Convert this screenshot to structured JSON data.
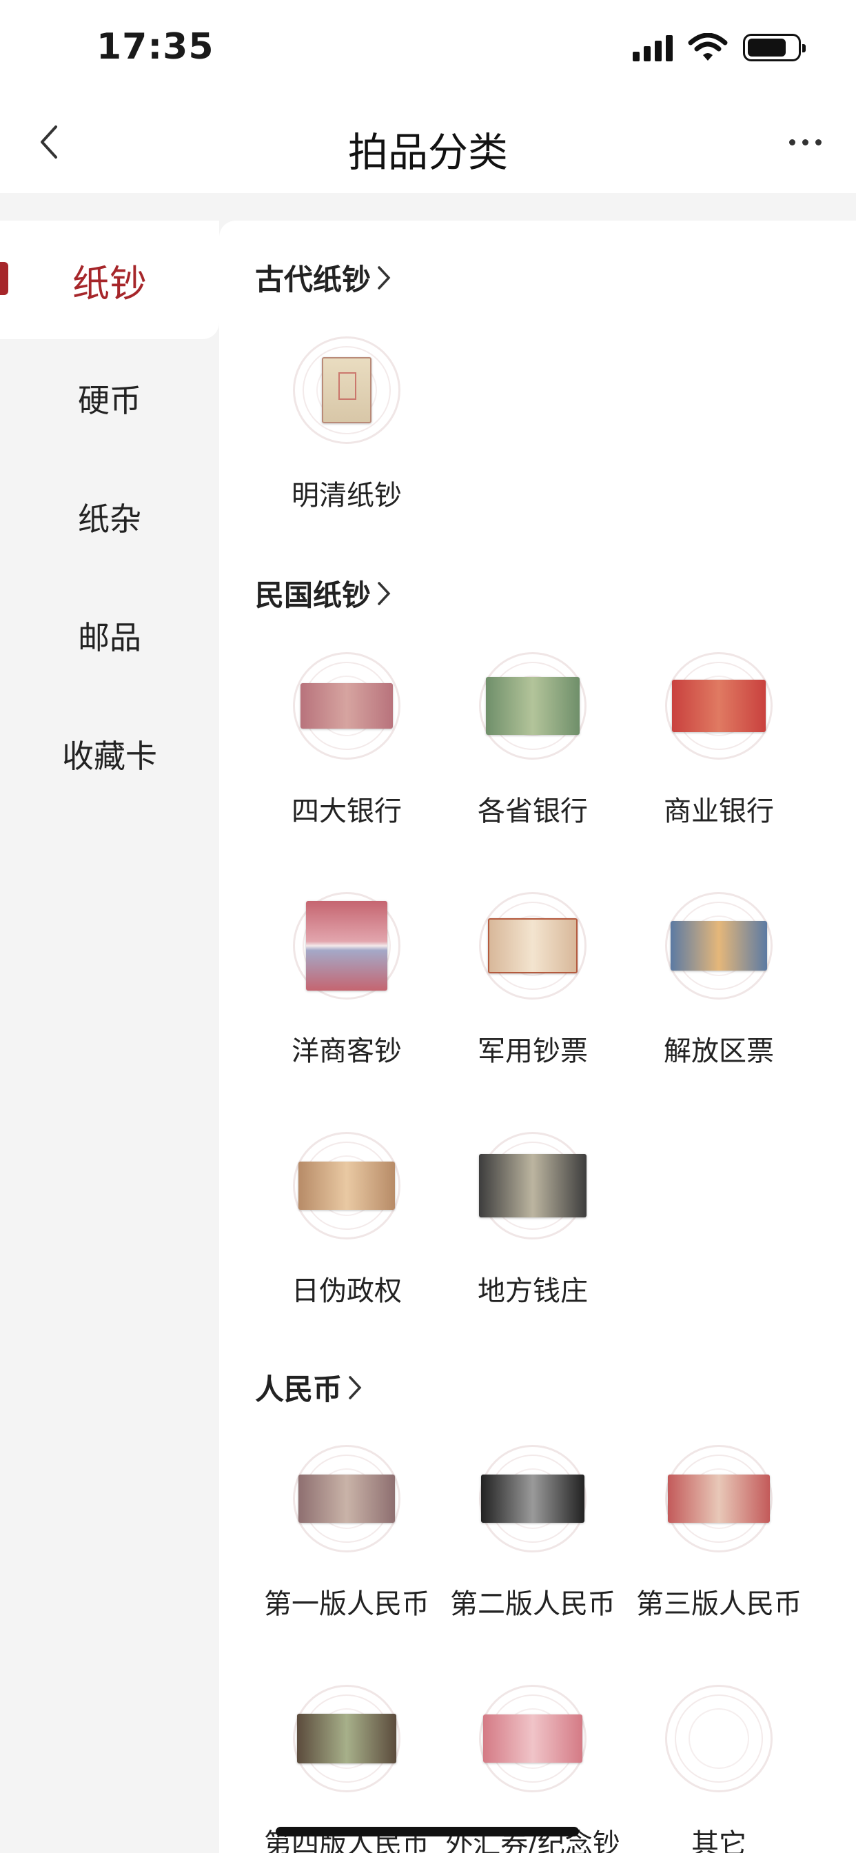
{
  "status_bar": {
    "time": "17:35"
  },
  "nav": {
    "title": "拍品分类"
  },
  "sidebar": {
    "items": [
      {
        "label": "纸钞",
        "active": true
      },
      {
        "label": "硬币"
      },
      {
        "label": "纸杂"
      },
      {
        "label": "邮品"
      },
      {
        "label": "收藏卡"
      }
    ]
  },
  "sections": [
    {
      "title": "古代纸钞",
      "items": [
        "明清纸钞"
      ]
    },
    {
      "title": "民国纸钞",
      "items": [
        "四大银行",
        "各省银行",
        "商业银行",
        "洋商客钞",
        "军用钞票",
        "解放区票",
        "日伪政权",
        "地方钱庄"
      ]
    },
    {
      "title": "人民币",
      "items": [
        "第一版人民币",
        "第二版人民币",
        "第三版人民币",
        "第四版人民币",
        "外汇券/纪念钞",
        "其它"
      ]
    }
  ],
  "colors": {
    "accent": "#a6262a",
    "background": "#f4f4f4",
    "panel": "#ffffff"
  }
}
